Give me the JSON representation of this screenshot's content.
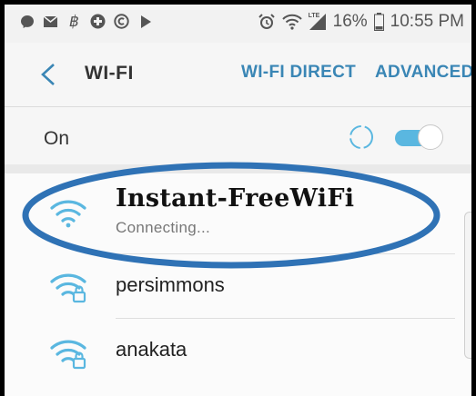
{
  "statusbar": {
    "left_icons": [
      "messenger-icon",
      "mail-icon",
      "bitcoin-icon",
      "plus-icon",
      "copyright-icon",
      "play-icon"
    ],
    "lte": "LTE",
    "battery": "16%",
    "time": "10:55 PM"
  },
  "header": {
    "title": "WI-FI",
    "wifi_direct": "WI-FI DIRECT",
    "advanced": "ADVANCED"
  },
  "toggle_row": {
    "label": "On",
    "enabled": true
  },
  "networks": [
    {
      "name": "Instant-FreeWiFi",
      "status": "Connecting...",
      "secured": false
    },
    {
      "name": "persimmons",
      "status": "",
      "secured": true
    },
    {
      "name": "anakata",
      "status": "",
      "secured": true
    }
  ],
  "colors": {
    "accent": "#3a86b5",
    "wifi_icon": "#5ab7e0",
    "highlight_ellipse": "#2f72b5"
  }
}
